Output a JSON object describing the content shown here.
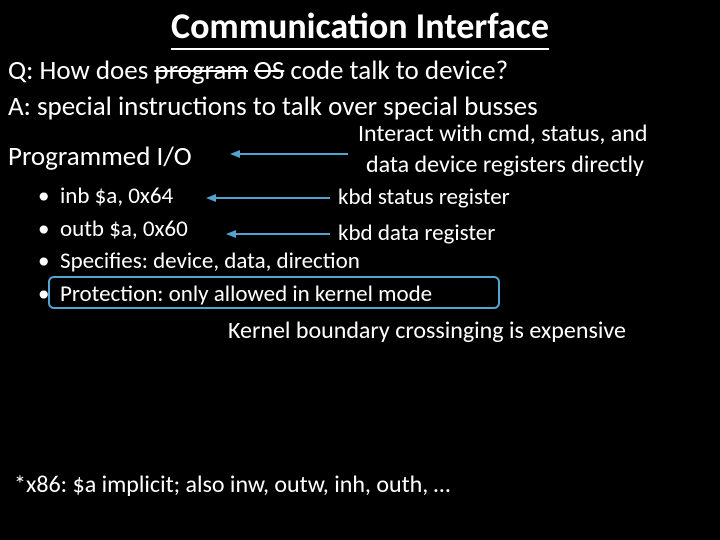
{
  "title": "Communication Interface",
  "q_prefix": "Q: How does ",
  "q_strike1": "program",
  "q_mid": "  ",
  "q_strike2": "OS",
  "q_suffix": " code talk to device?",
  "a_line": "A: special instructions to talk over special busses",
  "pio": "Programmed I/O",
  "interact_l1": "Interact with cmd, status, and",
  "interact_l2": "data device registers directly",
  "bullets": {
    "b1": "inb $a, 0x64",
    "b2": "outb $a, 0x60",
    "b3": "Specifies: device, data, direction",
    "b4": "Protection: only allowed in kernel mode"
  },
  "kbd_status": "kbd status register",
  "kbd_data": "kbd data register",
  "kernel_note": "Kernel boundary crossinging is expensive",
  "footnote": "*x86: $a implicit; also inw, outw, inh, outh, …",
  "colors": {
    "accent": "#53a5cf"
  }
}
